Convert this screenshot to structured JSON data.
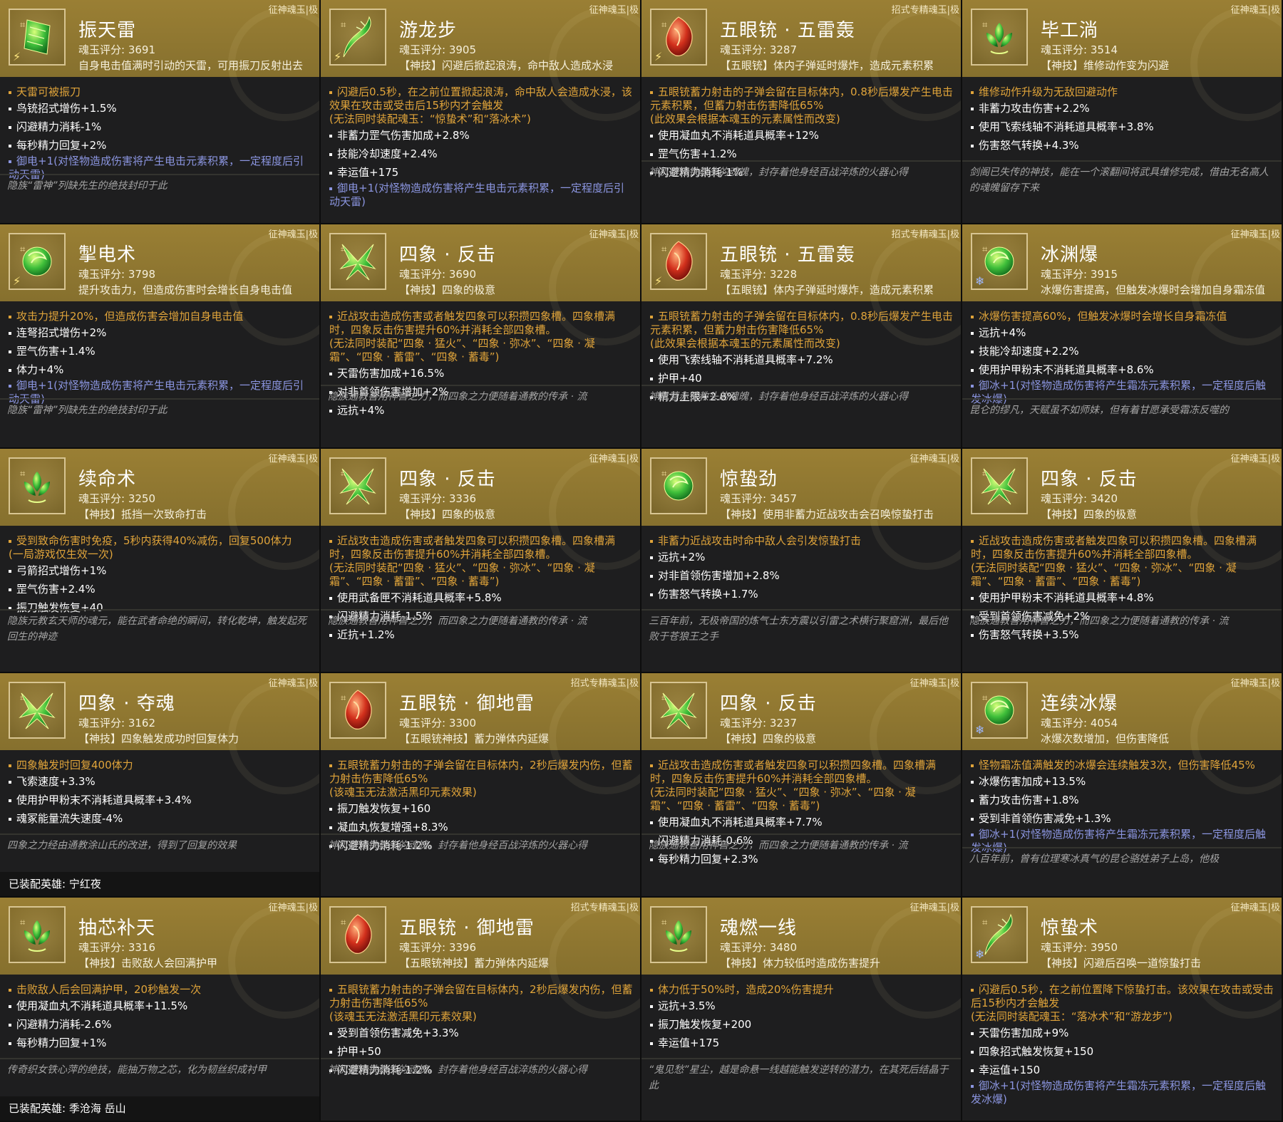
{
  "palette": {
    "header": "#9a7f34",
    "panel": "#1e1e1f",
    "main_effect": "#e0a43a",
    "stat": "#ffffff",
    "bonus": "#8b95e0",
    "flavor": "#a4a4a4"
  },
  "cards": [
    {
      "tag": "征神魂玉|极",
      "name": "振天雷",
      "score": "魂玉评分: 3691",
      "subtitle": "自身电击值满时引动的天雷，可用振刀反射出去",
      "gem": "green-scroll",
      "element_icon": "lightning-icon",
      "effects": [
        {
          "type": "main",
          "text": "天雷可被振刀"
        },
        {
          "type": "stat",
          "text": "鸟铳招式增伤+1.5%"
        },
        {
          "type": "stat",
          "text": "闪避精力消耗-1%"
        },
        {
          "type": "stat",
          "text": "每秒精力回复+2%"
        },
        {
          "type": "bonus",
          "text": "御电+1(对怪物造成伤害将产生电击元素积累，一定程度后引动天雷)"
        }
      ],
      "flavor": "隐族“雷神”列缺先生的绝技封印于此"
    },
    {
      "tag": "征神魂玉|极",
      "name": "游龙步",
      "score": "魂玉评分: 3905",
      "subtitle": "【神技】闪避后掀起浪涛，命中敌人造成水浸",
      "gem": "green-dragon",
      "element_icon": "lightning-icon",
      "effects": [
        {
          "type": "main",
          "text": "闪避后0.5秒，在之前位置掀起浪涛，命中敌人会造成水浸，该效果在攻击或受击后15秒内才会触发"
        },
        {
          "type": "note",
          "text": "(无法同时装配魂玉：“惊蛰术”和“落冰术”)"
        },
        {
          "type": "stat",
          "text": "非蓄力罡气伤害加成+2.8%"
        },
        {
          "type": "stat",
          "text": "技能冷却速度+2.4%"
        },
        {
          "type": "stat",
          "text": "幸运值+175"
        },
        {
          "type": "bonus",
          "text": "御电+1(对怪物造成伤害将产生电击元素积累，一定程度后引动天雷)"
        }
      ],
      "flavor": ""
    },
    {
      "tag": "招式专精魂玉|极",
      "name": "五眼铳 · 五雷轰",
      "score": "魂玉评分: 3287",
      "subtitle": "【五眼铳】体内子弹延时爆炸，造成元素积累",
      "gem": "red-crest",
      "element_icon": "lightning-icon",
      "effects": [
        {
          "type": "main",
          "text": "五眼铳蓄力射击的子弹会留在目标体内，0.8秒后爆发产生电击元素积累，但蓄力射击伤害降低65%"
        },
        {
          "type": "note",
          "text": "(此效果会根据本魂玉的元素属性而改变)"
        },
        {
          "type": "stat",
          "text": "使用凝血丸不消耗道具概率+12%"
        },
        {
          "type": "stat",
          "text": "罡气伤害+1.2%"
        },
        {
          "type": "stat",
          "text": "闪避精力消耗-1%"
        }
      ],
      "flavor": "神机营赤铁教头的魂魄，封存着他身经百战淬炼的火器心得"
    },
    {
      "tag": "征神魂玉|极",
      "name": "毕工淌",
      "score": "魂玉评分: 3514",
      "subtitle": "【神技】维修动作变为闪避",
      "gem": "green-flower",
      "element_icon": "",
      "effects": [
        {
          "type": "main",
          "text": "维修动作升级为无敌回避动作"
        },
        {
          "type": "stat",
          "text": "非蓄力攻击伤害+2.2%"
        },
        {
          "type": "stat",
          "text": "使用飞索线轴不消耗道具概率+3.8%"
        },
        {
          "type": "stat",
          "text": "伤害怒气转换+4.3%"
        }
      ],
      "flavor": "剑阁已失传的神技，能在一个滚翻间将武具维修完成，借由无名高人的魂魄留存下来"
    },
    {
      "tag": "征神魂玉|极",
      "name": "掣电术",
      "score": "魂玉评分: 3798",
      "subtitle": "提升攻击力，但造成伤害时会增长自身电击值",
      "gem": "green-orb",
      "element_icon": "lightning-icon",
      "effects": [
        {
          "type": "main",
          "text": "攻击力提升20%，但造成伤害会增加自身电击值"
        },
        {
          "type": "stat",
          "text": "连弩招式增伤+2%"
        },
        {
          "type": "stat",
          "text": "罡气伤害+1.4%"
        },
        {
          "type": "stat",
          "text": "体力+4%"
        },
        {
          "type": "bonus",
          "text": "御电+1(对怪物造成伤害将产生电击元素积累，一定程度后引动天雷)"
        }
      ],
      "flavor": "隐族“雷神”列缺先生的绝技封印于此"
    },
    {
      "tag": "征神魂玉|极",
      "name": "四象 · 反击",
      "score": "魂玉评分: 3690",
      "subtitle": "【神技】四象的极意",
      "gem": "green-butterfly",
      "element_icon": "",
      "effects": [
        {
          "type": "main",
          "text": "近战攻击造成伤害或者触发四象可以积攒四象槽。四象槽满时，四象反击伤害提升60%并消耗全部四象槽。"
        },
        {
          "type": "note",
          "text": "(无法同时装配“四象 · 猛火”、“四象 · 弥冰”、“四象 · 凝霜”、“四象 · 蓄雷”、“四象 · 蓄毒”)"
        },
        {
          "type": "stat",
          "text": "天雷伤害加成+16.5%"
        },
        {
          "type": "stat",
          "text": "对非首领伤害增加+2%"
        },
        {
          "type": "stat",
          "text": "远抗+4%"
        }
      ],
      "flavor": "隐族通教善用神兽之力，而四象之力便随着通教的传承 · 流"
    },
    {
      "tag": "招式专精魂玉|极",
      "name": "五眼铳 · 五雷轰",
      "score": "魂玉评分: 3228",
      "subtitle": "【五眼铳】体内子弹延时爆炸，造成元素积累",
      "gem": "red-crest",
      "element_icon": "lightning-icon",
      "effects": [
        {
          "type": "main",
          "text": "五眼铳蓄力射击的子弹会留在目标体内，0.8秒后爆发产生电击元素积累，但蓄力射击伤害降低65%"
        },
        {
          "type": "note",
          "text": "(此效果会根据本魂玉的元素属性而改变)"
        },
        {
          "type": "stat",
          "text": "使用飞索线轴不消耗道具概率+7.2%"
        },
        {
          "type": "stat",
          "text": "护甲+40"
        },
        {
          "type": "stat",
          "text": "精力上限+2.8%"
        }
      ],
      "flavor": "神机营赤铁教头的魂魄，封存着他身经百战淬炼的火器心得"
    },
    {
      "tag": "征神魂玉|极",
      "name": "冰渊爆",
      "score": "魂玉评分: 3915",
      "subtitle": "冰爆伤害提高，但触发冰爆时会增加自身霜冻值",
      "gem": "green-orb",
      "element_icon": "snowflake-icon",
      "effects": [
        {
          "type": "main",
          "text": "冰爆伤害提高60%，但触发冰爆时会增长自身霜冻值"
        },
        {
          "type": "stat",
          "text": "远抗+4%"
        },
        {
          "type": "stat",
          "text": "技能冷却速度+2.2%"
        },
        {
          "type": "stat",
          "text": "使用护甲粉末不消耗道具概率+8.6%"
        },
        {
          "type": "bonus",
          "text": "御冰+1(对怪物造成伤害将产生霜冻元素积累，一定程度后触发冰爆)"
        }
      ],
      "flavor": "昆仑的缪凡，天赋虽不如师妹，但有着甘愿承受霜冻反噬的"
    },
    {
      "tag": "征神魂玉|极",
      "name": "续命术",
      "score": "魂玉评分: 3250",
      "subtitle": "【神技】抵挡一次致命打击",
      "gem": "green-flower",
      "element_icon": "",
      "effects": [
        {
          "type": "main",
          "text": "受到致命伤害时免疫，5秒内获得40%减伤，回复500体力"
        },
        {
          "type": "note",
          "text": "(一局游戏仅生效一次)"
        },
        {
          "type": "stat",
          "text": "弓箭招式增伤+1%"
        },
        {
          "type": "stat",
          "text": "罡气伤害+2.4%"
        },
        {
          "type": "stat",
          "text": "振刀触发恢复+40"
        }
      ],
      "flavor": "隐族元教玄天师的魂元，能在武者命绝的瞬间，转化乾坤，触发起死回生的神迹"
    },
    {
      "tag": "征神魂玉|极",
      "name": "四象 · 反击",
      "score": "魂玉评分: 3336",
      "subtitle": "【神技】四象的极意",
      "gem": "green-butterfly",
      "element_icon": "",
      "effects": [
        {
          "type": "main",
          "text": "近战攻击造成伤害或者触发四象可以积攒四象槽。四象槽满时，四象反击伤害提升60%并消耗全部四象槽。"
        },
        {
          "type": "note",
          "text": "(无法同时装配“四象 · 猛火”、“四象 · 弥冰”、“四象 · 凝霜”、“四象 · 蓄雷”、“四象 · 蓄毒”)"
        },
        {
          "type": "stat",
          "text": "使用武备匣不消耗道具概率+5.8%"
        },
        {
          "type": "stat",
          "text": "闪避精力消耗-1.5%"
        },
        {
          "type": "stat",
          "text": "近抗+1.2%"
        }
      ],
      "flavor": "隐族通教善用神兽之力，而四象之力便随着通教的传承 · 流"
    },
    {
      "tag": "征神魂玉|极",
      "name": "惊蛰劲",
      "score": "魂玉评分: 3457",
      "subtitle": "【神技】使用非蓄力近战攻击会召唤惊蛰打击",
      "gem": "green-orb",
      "element_icon": "",
      "effects": [
        {
          "type": "main",
          "text": "非蓄力近战攻击时命中敌人会引发惊蛰打击"
        },
        {
          "type": "stat",
          "text": "远抗+2%"
        },
        {
          "type": "stat",
          "text": "对非首领伤害增加+2.8%"
        },
        {
          "type": "stat",
          "text": "伤害怒气转换+1.7%"
        }
      ],
      "flavor": "三百年前，无极帝国的炼气士东方震以引雷之术横行聚窟洲，最后他败于苍狼王之手"
    },
    {
      "tag": "征神魂玉|极",
      "name": "四象 · 反击",
      "score": "魂玉评分: 3420",
      "subtitle": "【神技】四象的极意",
      "gem": "green-butterfly",
      "element_icon": "",
      "effects": [
        {
          "type": "main",
          "text": "近战攻击造成伤害或者触发四象可以积攒四象槽。四象槽满时，四象反击伤害提升60%并消耗全部四象槽。"
        },
        {
          "type": "note",
          "text": "(无法同时装配“四象 · 猛火”、“四象 · 弥冰”、“四象 · 凝霜”、“四象 · 蓄雷”、“四象 · 蓄毒”)"
        },
        {
          "type": "stat",
          "text": "使用护甲粉末不消耗道具概率+4.8%"
        },
        {
          "type": "stat",
          "text": "受到首领伤害减免+2%"
        },
        {
          "type": "stat",
          "text": "伤害怒气转换+3.5%"
        }
      ],
      "flavor": "隐族通教善用神兽之力，而四象之力便随着通教的传承 · 流"
    },
    {
      "tag": "征神魂玉|极",
      "name": "四象 · 夺魂",
      "score": "魂玉评分: 3162",
      "subtitle": "【神技】四象触发成功时回复体力",
      "gem": "green-butterfly",
      "element_icon": "",
      "effects": [
        {
          "type": "main",
          "text": "四象触发时回复400体力"
        },
        {
          "type": "stat",
          "text": "飞索速度+3.3%"
        },
        {
          "type": "stat",
          "text": "使用护甲粉末不消耗道具概率+3.4%"
        },
        {
          "type": "stat",
          "text": "魂冢能量流失速度-4%"
        }
      ],
      "flavor": "四象之力经由通教涂山氏的改进，得到了回复的效果",
      "equipped": "已装配英雄: 宁红夜"
    },
    {
      "tag": "招式专精魂玉|极",
      "name": "五眼铳 · 御地雷",
      "score": "魂玉评分: 3300",
      "subtitle": "【五眼铳神技】蓄力弹体内延爆",
      "gem": "red-crest",
      "element_icon": "",
      "effects": [
        {
          "type": "main",
          "text": "五眼铳蓄力射击的子弹会留在目标体内，2秒后爆发内伤，但蓄力射击伤害降低65%"
        },
        {
          "type": "note",
          "text": "(该魂玉无法激活黑印元素效果)"
        },
        {
          "type": "stat",
          "text": "振刀触发恢复+160"
        },
        {
          "type": "stat",
          "text": "凝血丸恢复增强+8.3%"
        },
        {
          "type": "stat",
          "text": "闪避精力消耗-1.2%"
        }
      ],
      "flavor": "神机营赤铁教头的魂魄，封存着他身经百战淬炼的火器心得"
    },
    {
      "tag": "征神魂玉|极",
      "name": "四象 · 反击",
      "score": "魂玉评分: 3237",
      "subtitle": "【神技】四象的极意",
      "gem": "green-butterfly",
      "element_icon": "",
      "effects": [
        {
          "type": "main",
          "text": "近战攻击造成伤害或者触发四象可以积攒四象槽。四象槽满时，四象反击伤害提升60%并消耗全部四象槽。"
        },
        {
          "type": "note",
          "text": "(无法同时装配“四象 · 猛火”、“四象 · 弥冰”、“四象 · 凝霜”、“四象 · 蓄雷”、“四象 · 蓄毒”)"
        },
        {
          "type": "stat",
          "text": "使用凝血丸不消耗道具概率+7.7%"
        },
        {
          "type": "stat",
          "text": "闪避精力消耗-0.6%"
        },
        {
          "type": "stat",
          "text": "每秒精力回复+2.3%"
        }
      ],
      "flavor": "隐族通教善用神兽之力，而四象之力便随着通教的传承 · 流"
    },
    {
      "tag": "征神魂玉|极",
      "name": "连续冰爆",
      "score": "魂玉评分: 4054",
      "subtitle": "冰爆次数增加，但伤害降低",
      "gem": "green-orb",
      "element_icon": "snowflake-icon",
      "effects": [
        {
          "type": "main",
          "text": "怪物霜冻值满触发的冰爆会连续触发3次，但伤害降低45%"
        },
        {
          "type": "stat",
          "text": "冰爆伤害加成+13.5%"
        },
        {
          "type": "stat",
          "text": "蓄力攻击伤害+1.8%"
        },
        {
          "type": "stat",
          "text": "受到非首领伤害减免+1.3%"
        },
        {
          "type": "bonus",
          "text": "御冰+1(对怪物造成伤害将产生霜冻元素积累，一定程度后触发冰爆)"
        }
      ],
      "flavor": "八百年前，曾有位理寒冰真气的昆仑骆姓弟子上岛，他极"
    },
    {
      "tag": "征神魂玉|极",
      "name": "抽芯补天",
      "score": "魂玉评分: 3316",
      "subtitle": "【神技】击败敌人会回满护甲",
      "gem": "green-flower",
      "element_icon": "",
      "effects": [
        {
          "type": "main",
          "text": "击败敌人后会回满护甲，20秒触发一次"
        },
        {
          "type": "stat",
          "text": "使用凝血丸不消耗道具概率+11.5%"
        },
        {
          "type": "stat",
          "text": "闪避精力消耗-2.6%"
        },
        {
          "type": "stat",
          "text": "每秒精力回复+1%"
        }
      ],
      "flavor": "传奇织女铁心萍的绝技，能抽万物之芯，化为韧丝织成衬甲",
      "equipped": "已装配英雄: 季沧海 岳山"
    },
    {
      "tag": "招式专精魂玉|极",
      "name": "五眼铳 · 御地雷",
      "score": "魂玉评分: 3396",
      "subtitle": "【五眼铳神技】蓄力弹体内延爆",
      "gem": "red-crest",
      "element_icon": "",
      "effects": [
        {
          "type": "main",
          "text": "五眼铳蓄力射击的子弹会留在目标体内，2秒后爆发内伤，但蓄力射击伤害降低65%"
        },
        {
          "type": "note",
          "text": "(该魂玉无法激活黑印元素效果)"
        },
        {
          "type": "stat",
          "text": "受到首领伤害减免+3.3%"
        },
        {
          "type": "stat",
          "text": "护甲+50"
        },
        {
          "type": "stat",
          "text": "闪避精力消耗-1.2%"
        }
      ],
      "flavor": "神机营赤铁教头的魂魄，封存着他身经百战淬炼的火器心得"
    },
    {
      "tag": "征神魂玉|极",
      "name": "魂燃一线",
      "score": "魂玉评分: 3480",
      "subtitle": "【神技】体力较低时造成伤害提升",
      "gem": "green-flower",
      "element_icon": "",
      "effects": [
        {
          "type": "main",
          "text": "体力低于50%时，造成20%伤害提升"
        },
        {
          "type": "stat",
          "text": "远抗+3.5%"
        },
        {
          "type": "stat",
          "text": "振刀触发恢复+200"
        },
        {
          "type": "stat",
          "text": "幸运值+175"
        }
      ],
      "flavor": "“鬼见愁”星尘，越是命悬一线越能触发逆转的潜力，在其死后结晶于此"
    },
    {
      "tag": "征神魂玉|极",
      "name": "惊蛰术",
      "score": "魂玉评分: 3950",
      "subtitle": "【神技】闪避后召唤一道惊蛰打击",
      "gem": "green-dragon",
      "element_icon": "snowflake-icon",
      "effects": [
        {
          "type": "main",
          "text": "闪避后0.5秒，在之前位置降下惊蛰打击。该效果在攻击或受击后15秒内才会触发"
        },
        {
          "type": "note",
          "text": "(无法同时装配魂玉：“落冰术”和“游龙步”)"
        },
        {
          "type": "stat",
          "text": "天雷伤害加成+9%"
        },
        {
          "type": "stat",
          "text": "四象招式触发恢复+150"
        },
        {
          "type": "stat",
          "text": "幸运值+150"
        },
        {
          "type": "bonus",
          "text": "御冰+1(对怪物造成伤害将产生霜冻元素积累，一定程度后触发冰爆)"
        }
      ],
      "flavor": ""
    }
  ]
}
